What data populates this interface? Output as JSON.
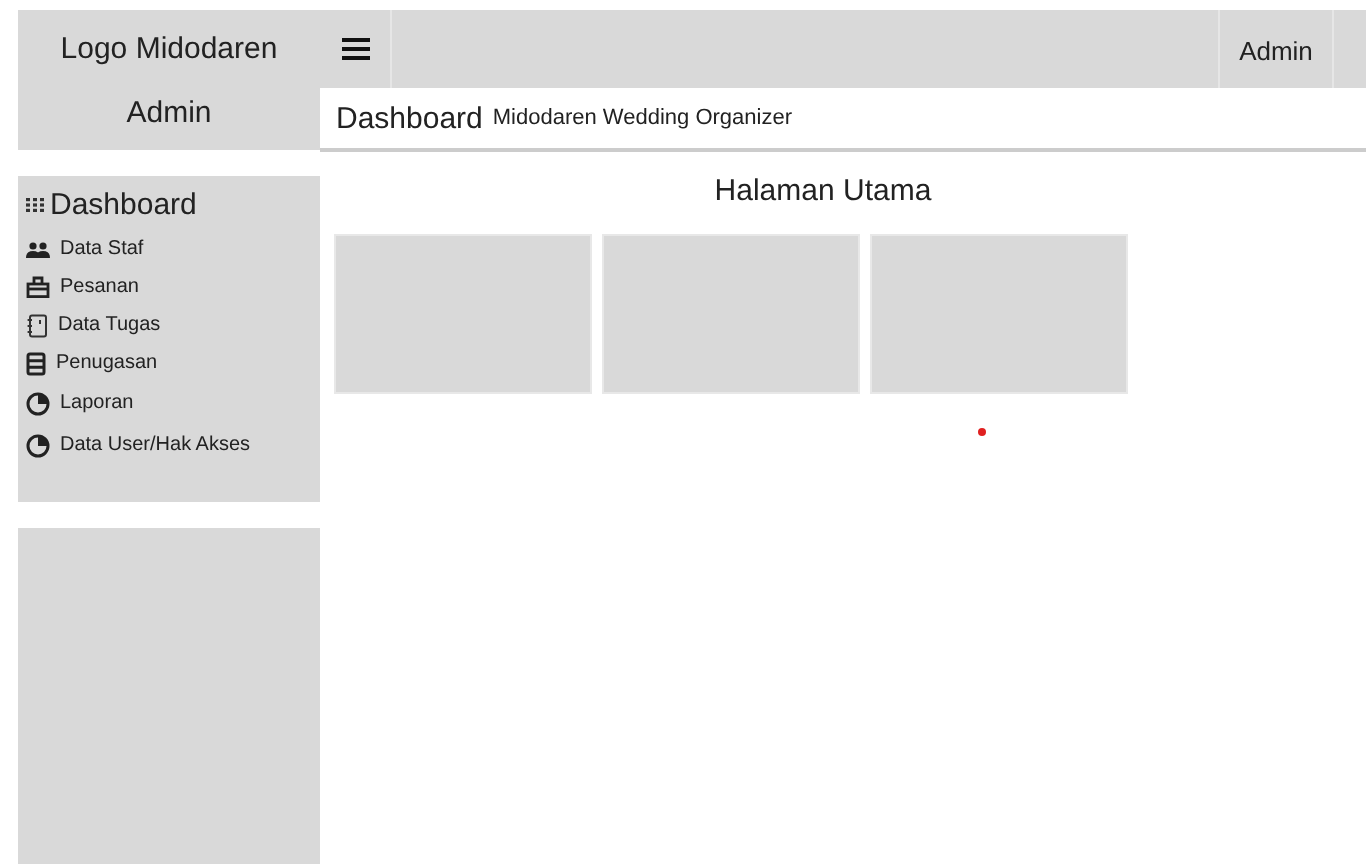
{
  "brand": "Logo Midodaren",
  "role": "Admin",
  "topbar": {
    "user": "Admin"
  },
  "breadcrumb": {
    "title": "Dashboard",
    "subtitle": "Midodaren Wedding Organizer"
  },
  "sidebar": {
    "heading": "Dashboard",
    "items": [
      {
        "label": "Data Staf",
        "kind": "people"
      },
      {
        "label": "Pesanan",
        "kind": "bag"
      },
      {
        "label": "Data Tugas",
        "kind": "notebook"
      },
      {
        "label": "Penugasan",
        "kind": "list"
      },
      {
        "label": "Laporan",
        "kind": "pie"
      },
      {
        "label": "Data User/Hak Akses",
        "kind": "pie"
      }
    ]
  },
  "main": {
    "title": "Halaman Utama",
    "cards": [
      {
        "kind": "placeholder"
      },
      {
        "kind": "placeholder"
      },
      {
        "kind": "placeholder"
      }
    ]
  }
}
